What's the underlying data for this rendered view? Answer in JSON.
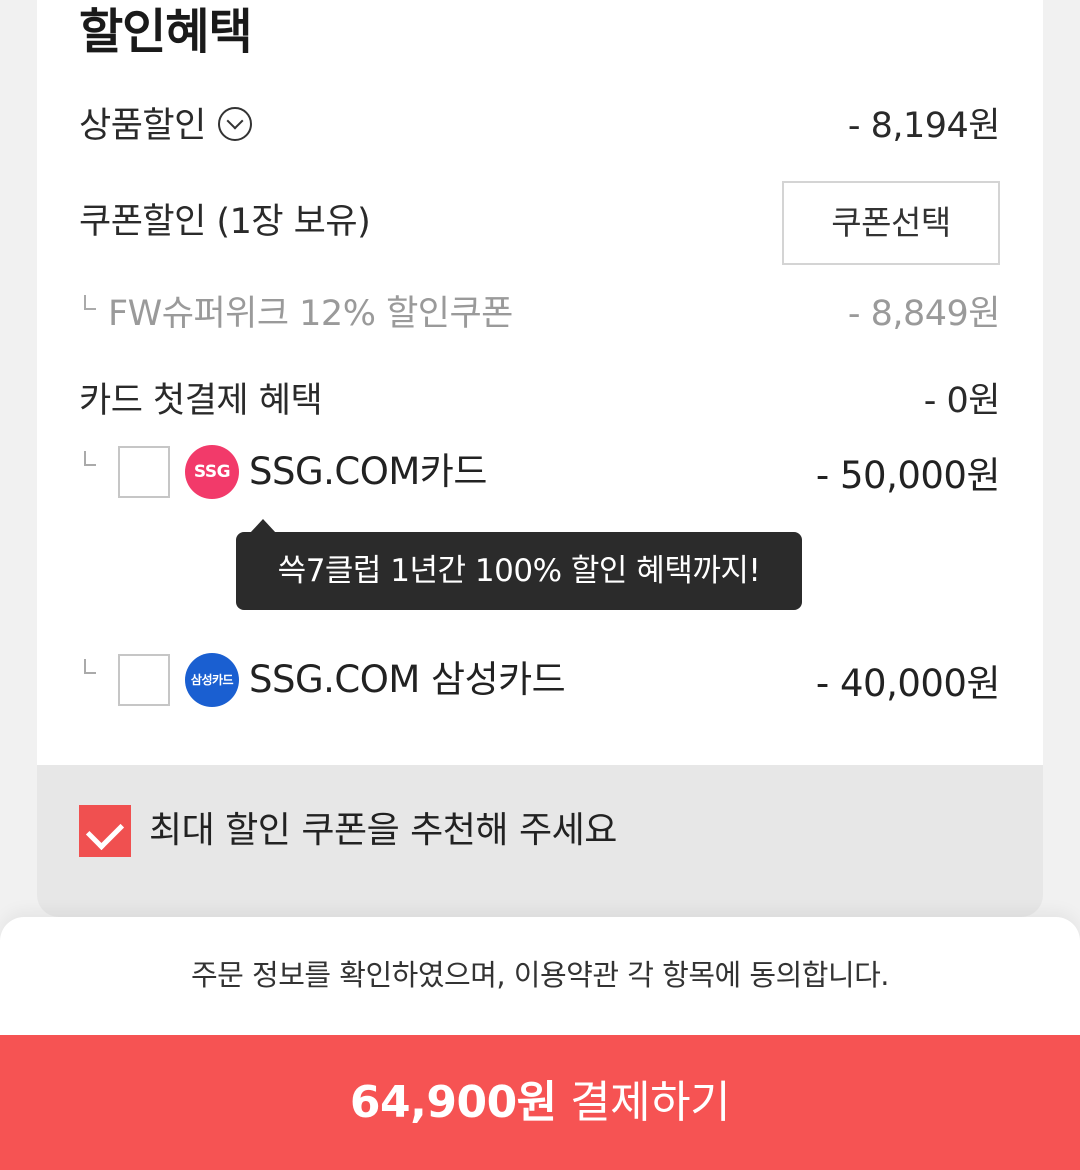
{
  "section": {
    "title": "할인혜택"
  },
  "product_discount": {
    "label": "상품할인",
    "amount": "- 8,194원",
    "icon": "chevron-down-circle-icon"
  },
  "coupon_discount": {
    "label": "쿠폰할인 (1장 보유)",
    "select_button": "쿠폰선택"
  },
  "applied_coupon": {
    "name": "FW슈퍼위크 12% 할인쿠폰",
    "amount": "- 8,849원"
  },
  "card_benefit": {
    "label": "카드 첫결제 혜택",
    "amount": "- 0원"
  },
  "cards": [
    {
      "logo_text": "SSG",
      "name": "SSG.COM카드",
      "amount": "- 50,000원",
      "checked": false,
      "logo_color": "#f23a6a"
    },
    {
      "logo_text": "삼성카드",
      "name": "SSG.COM 삼성카드",
      "amount": "- 40,000원",
      "checked": false,
      "logo_color": "#1a5fd1"
    }
  ],
  "tooltip": {
    "text": "쓱7클럽 1년간 100% 할인 혜택까지!"
  },
  "recommend": {
    "label": "최대 할인 쿠폰을 추천해 주세요",
    "checked": true
  },
  "agreement": {
    "text": "주문 정보를 확인하였으며, 이용약관 각 항목에 동의합니다."
  },
  "pay": {
    "amount": "64,900원",
    "label": "결제하기"
  },
  "colors": {
    "accent": "#f65353",
    "checkbox_checked": "#f05050",
    "tooltip_bg": "#2b2b2b"
  }
}
